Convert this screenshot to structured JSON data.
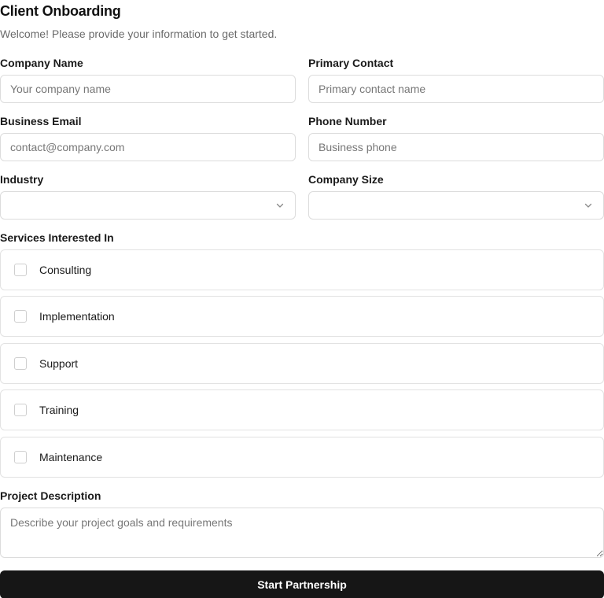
{
  "form": {
    "title": "Client Onboarding",
    "subtitle": "Welcome! Please provide your information to get started."
  },
  "fields": {
    "company_name": {
      "label": "Company Name",
      "placeholder": "Your company name",
      "value": ""
    },
    "primary_contact": {
      "label": "Primary Contact",
      "placeholder": "Primary contact name",
      "value": ""
    },
    "business_email": {
      "label": "Business Email",
      "placeholder": "contact@company.com",
      "value": ""
    },
    "phone_number": {
      "label": "Phone Number",
      "placeholder": "Business phone",
      "value": ""
    },
    "industry": {
      "label": "Industry",
      "selected": "",
      "icon": "chevron-down-icon"
    },
    "company_size": {
      "label": "Company Size",
      "selected": "",
      "icon": "chevron-down-icon"
    }
  },
  "services": {
    "label": "Services Interested In",
    "options": [
      {
        "label": "Consulting",
        "checked": false
      },
      {
        "label": "Implementation",
        "checked": false
      },
      {
        "label": "Support",
        "checked": false
      },
      {
        "label": "Training",
        "checked": false
      },
      {
        "label": "Maintenance",
        "checked": false
      }
    ]
  },
  "project_description": {
    "label": "Project Description",
    "placeholder": "Describe your project goals and requirements",
    "value": ""
  },
  "submit": {
    "label": "Start Partnership"
  },
  "colors": {
    "button_bg": "#161616",
    "border": "#dcdcdc",
    "muted_text": "#6b6b6b"
  }
}
